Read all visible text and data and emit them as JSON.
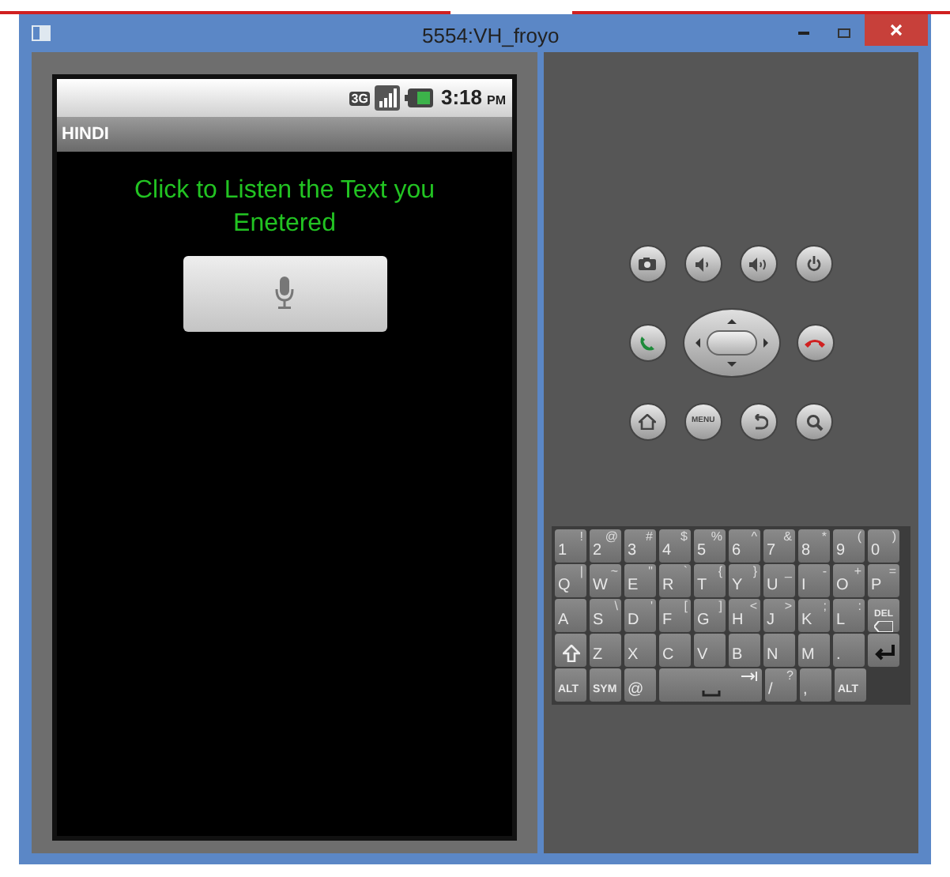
{
  "window": {
    "title": "5554:VH_froyo"
  },
  "status_bar": {
    "network": "3G",
    "time": "3:18",
    "ampm": "PM"
  },
  "app": {
    "title": "HINDI",
    "message": "Click to Listen the Text you Enetered"
  },
  "hardware_buttons": {
    "menu_label": "MENU"
  },
  "keyboard": [
    [
      {
        "kind": "char",
        "main": "1",
        "alt": "!"
      },
      {
        "kind": "char",
        "main": "2",
        "alt": "@"
      },
      {
        "kind": "char",
        "main": "3",
        "alt": "#"
      },
      {
        "kind": "char",
        "main": "4",
        "alt": "$"
      },
      {
        "kind": "char",
        "main": "5",
        "alt": "%"
      },
      {
        "kind": "char",
        "main": "6",
        "alt": "^"
      },
      {
        "kind": "char",
        "main": "7",
        "alt": "&"
      },
      {
        "kind": "char",
        "main": "8",
        "alt": "*"
      },
      {
        "kind": "char",
        "main": "9",
        "alt": "("
      },
      {
        "kind": "char",
        "main": "0",
        "alt": ")"
      }
    ],
    [
      {
        "kind": "char",
        "main": "Q",
        "alt": "|"
      },
      {
        "kind": "char",
        "main": "W",
        "alt": "~"
      },
      {
        "kind": "char",
        "main": "E",
        "alt": "\""
      },
      {
        "kind": "char",
        "main": "R",
        "alt": "`"
      },
      {
        "kind": "char",
        "main": "T",
        "alt": "{"
      },
      {
        "kind": "char",
        "main": "Y",
        "alt": "}"
      },
      {
        "kind": "char",
        "main": "U",
        "alt": "_"
      },
      {
        "kind": "char",
        "main": "I",
        "alt": "-"
      },
      {
        "kind": "char",
        "main": "O",
        "alt": "+"
      },
      {
        "kind": "char",
        "main": "P",
        "alt": "="
      }
    ],
    [
      {
        "kind": "char",
        "main": "A"
      },
      {
        "kind": "char",
        "main": "S",
        "alt": "\\"
      },
      {
        "kind": "char",
        "main": "D",
        "alt": "'"
      },
      {
        "kind": "char",
        "main": "F",
        "alt": "["
      },
      {
        "kind": "char",
        "main": "G",
        "alt": "]"
      },
      {
        "kind": "char",
        "main": "H",
        "alt": "<"
      },
      {
        "kind": "char",
        "main": "J",
        "alt": ">"
      },
      {
        "kind": "char",
        "main": "K",
        "alt": ";"
      },
      {
        "kind": "char",
        "main": "L",
        "alt": ":"
      },
      {
        "kind": "del",
        "main": "DEL"
      }
    ],
    [
      {
        "kind": "shift"
      },
      {
        "kind": "char",
        "main": "Z"
      },
      {
        "kind": "char",
        "main": "X"
      },
      {
        "kind": "char",
        "main": "C"
      },
      {
        "kind": "char",
        "main": "V"
      },
      {
        "kind": "char",
        "main": "B"
      },
      {
        "kind": "char",
        "main": "N"
      },
      {
        "kind": "char",
        "main": "M"
      },
      {
        "kind": "char",
        "main": "."
      },
      {
        "kind": "enter"
      }
    ],
    [
      {
        "kind": "small",
        "main": "ALT"
      },
      {
        "kind": "small",
        "main": "SYM"
      },
      {
        "kind": "char",
        "main": "@"
      },
      {
        "kind": "space"
      },
      {
        "kind": "char",
        "main": "/",
        "alt": "?"
      },
      {
        "kind": "char",
        "main": ","
      },
      {
        "kind": "small",
        "main": "ALT"
      }
    ]
  ]
}
